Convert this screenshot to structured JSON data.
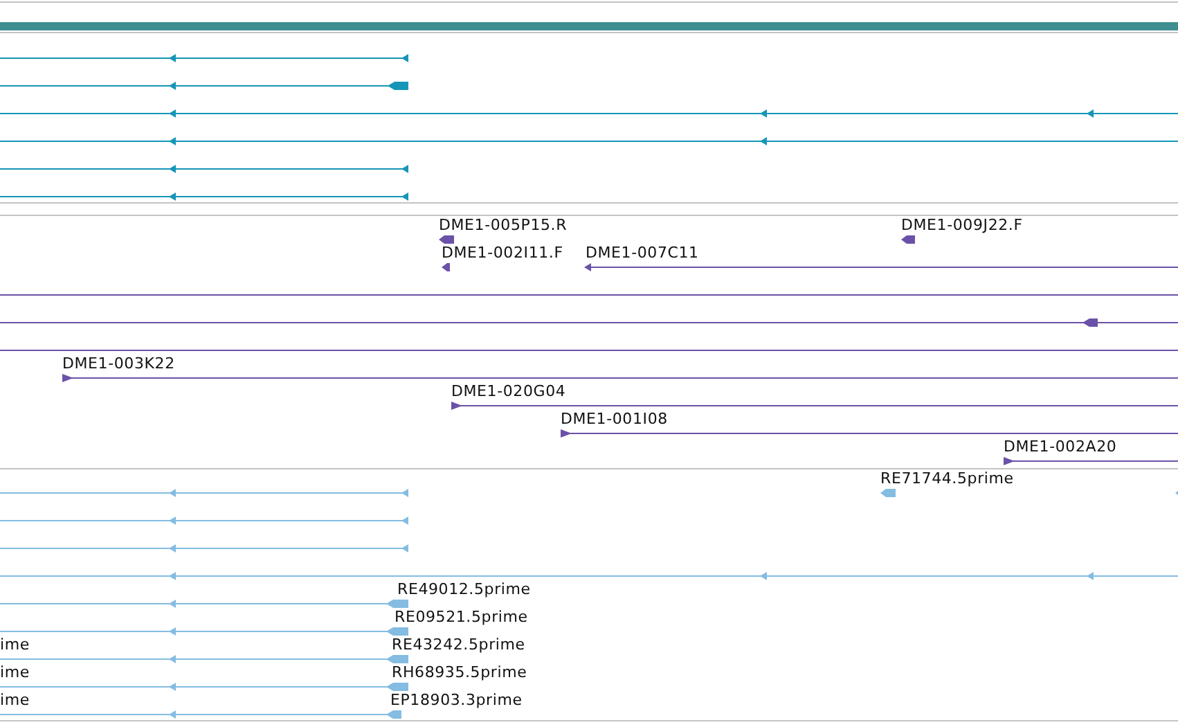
{
  "tracks": [
    {
      "color": "#1596b8"
    },
    {
      "color": "#6b52a8",
      "labels": [
        "DME1-005P15.R",
        "DME1-009J22.F",
        "DME1-002I11.F",
        "DME1-007C11",
        "DME1-003K22",
        "DME1-020G04",
        "DME1-001I08",
        "DME1-002A20"
      ]
    },
    {
      "color": "#84bce2",
      "labels": [
        "RE71744.5prime",
        "RE49012.5prime",
        "RE09521.5prime",
        "ime",
        "RE43242.5prime",
        "ime",
        "RH68935.5prime",
        "ime",
        "EP18903.3prime"
      ]
    }
  ]
}
